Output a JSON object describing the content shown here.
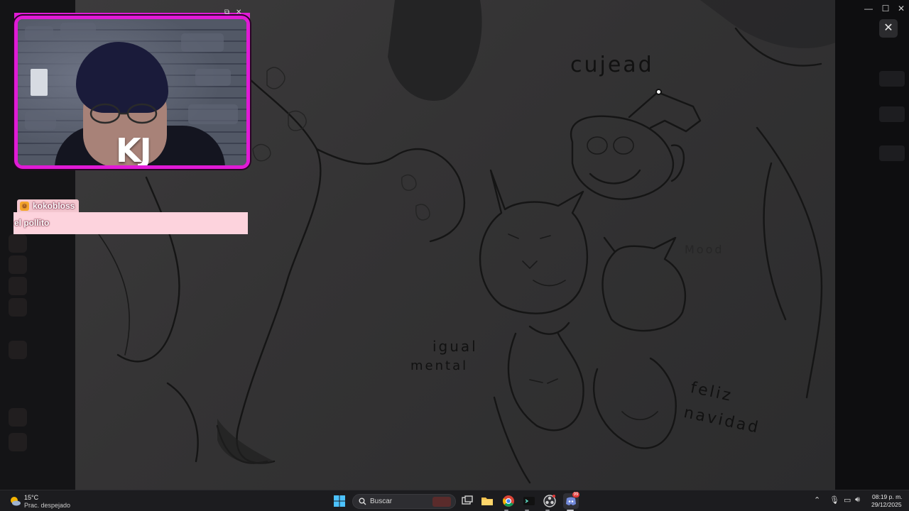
{
  "webcam": {
    "initials": "KJ"
  },
  "chat": {
    "username": "kokobloss",
    "message": "el pollito",
    "user_tag_color": "#f3c6cf",
    "message_bg_color": "#fdd3dd"
  },
  "drawing": {
    "label_cuphead": "cujead",
    "label_mood": "Mood",
    "label_igual": "igual",
    "label_mental": "mental",
    "label_feliz": "feliz",
    "label_navidad": "navidad"
  },
  "overlay": {
    "close_glyph": "✕",
    "minimize_glyph": "—",
    "maximize_glyph": "☐",
    "close_win_glyph": "✕"
  },
  "taskbar": {
    "weather_temp": "15°C",
    "weather_desc": "Prac. despejado",
    "search_placeholder": "Buscar",
    "time": "08:19 p. m.",
    "date": "29/12/2025",
    "discord_badge": "99",
    "accent_color": "#e11ad6"
  }
}
